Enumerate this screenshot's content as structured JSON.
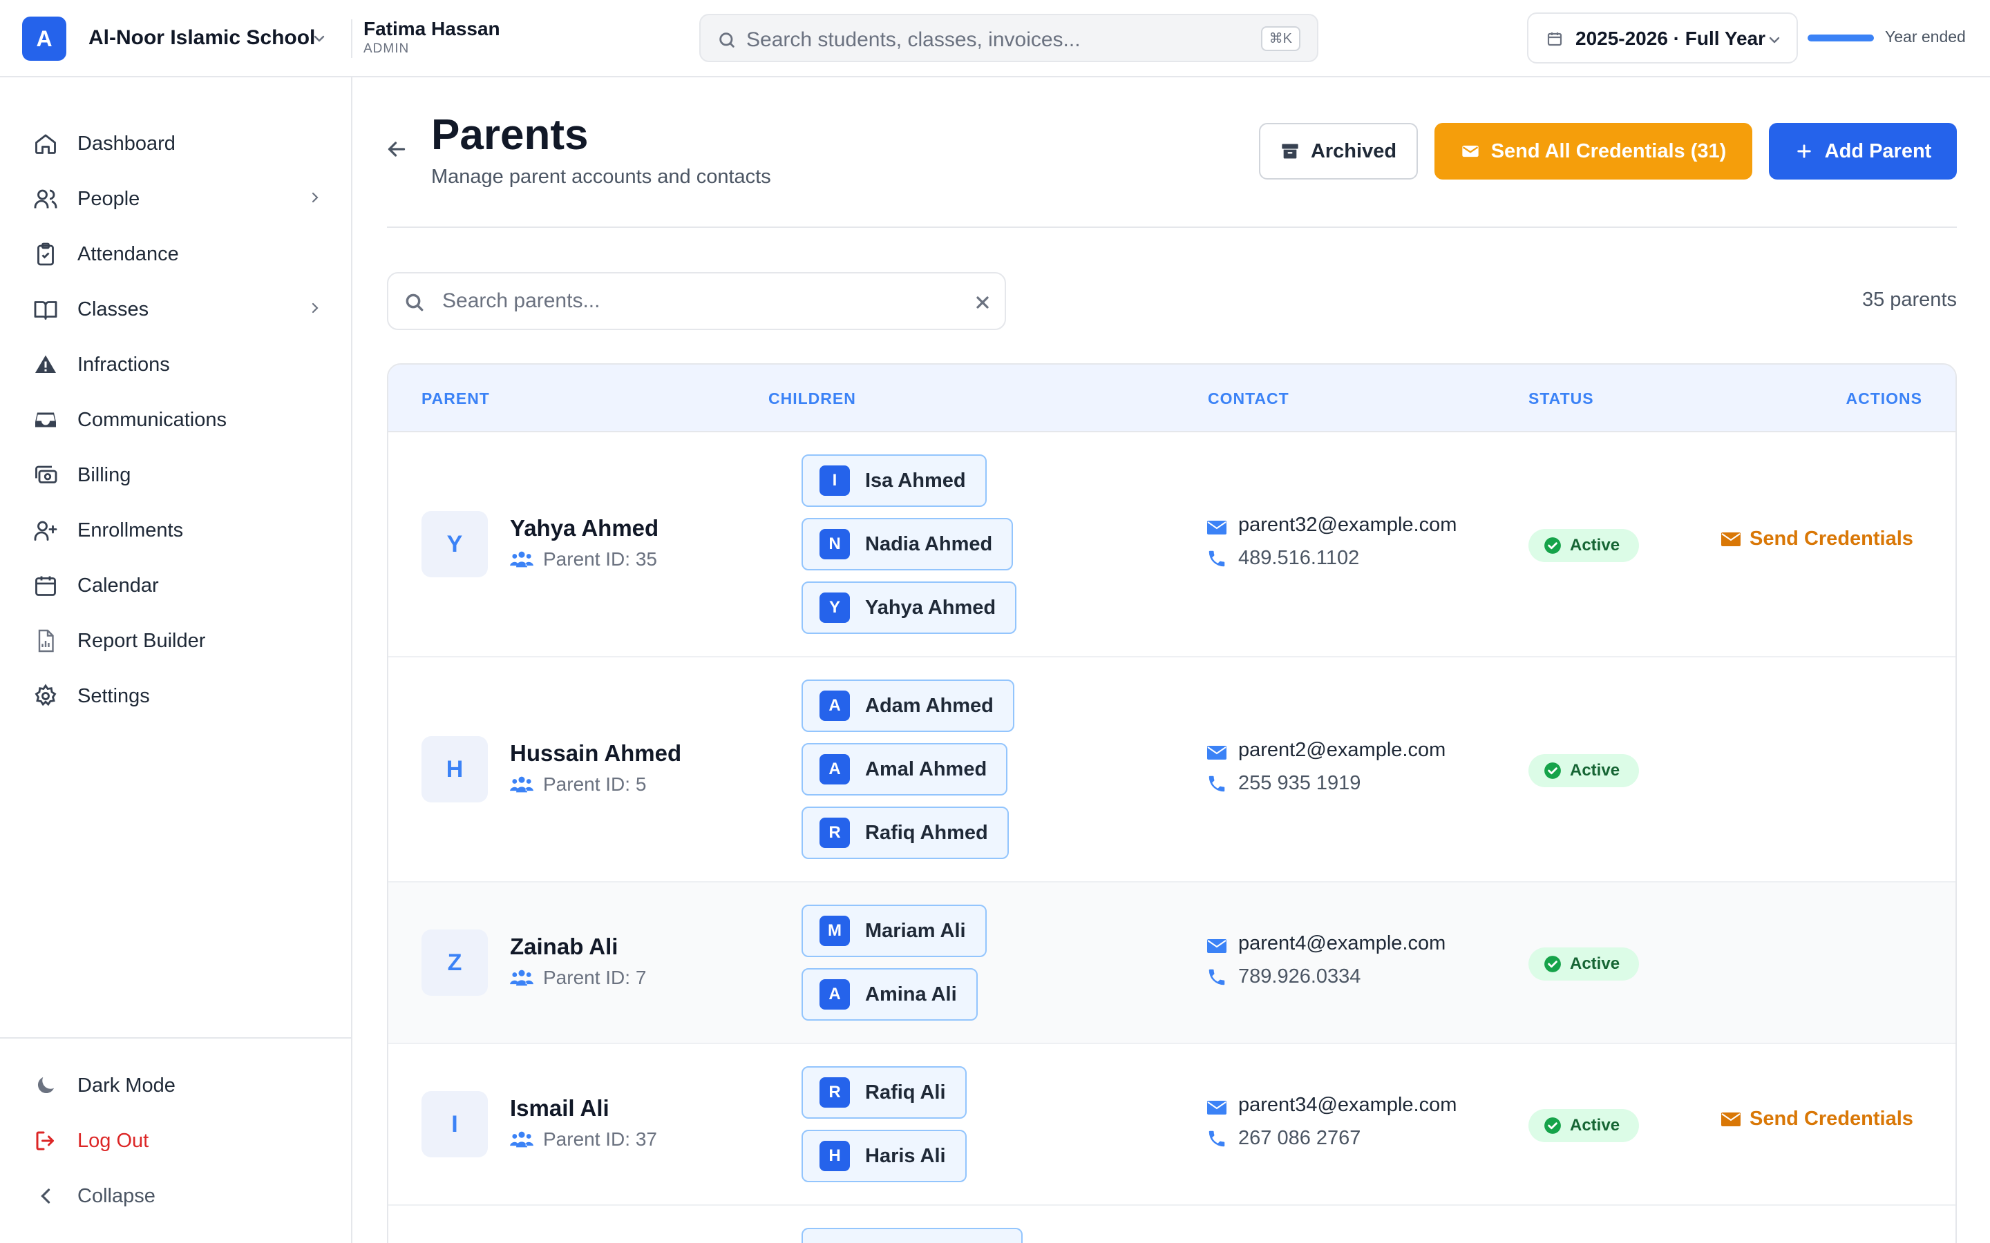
{
  "header": {
    "logo_letter": "A",
    "school_name": "Al-Noor Islamic School",
    "user_name": "Fatima Hassan",
    "user_role": "ADMIN",
    "search_placeholder": "Search students, classes, invoices...",
    "shortcut": "⌘K",
    "year_label": "2025-2026 · Full Year",
    "year_status": "Year ended",
    "year_progress_percent": 100
  },
  "sidebar": {
    "items": [
      {
        "label": "Dashboard",
        "icon": "home-icon"
      },
      {
        "label": "People",
        "icon": "users-icon",
        "has_submenu": true
      },
      {
        "label": "Attendance",
        "icon": "clipboard-check-icon"
      },
      {
        "label": "Classes",
        "icon": "book-open-icon",
        "has_submenu": true
      },
      {
        "label": "Infractions",
        "icon": "warning-triangle-icon"
      },
      {
        "label": "Communications",
        "icon": "inbox-icon"
      },
      {
        "label": "Billing",
        "icon": "billing-icon"
      },
      {
        "label": "Enrollments",
        "icon": "user-plus-icon"
      },
      {
        "label": "Calendar",
        "icon": "calendar-icon"
      },
      {
        "label": "Report Builder",
        "icon": "report-icon"
      },
      {
        "label": "Settings",
        "icon": "gear-icon"
      }
    ],
    "footer": {
      "dark_mode": "Dark Mode",
      "logout": "Log Out",
      "collapse": "Collapse"
    }
  },
  "page": {
    "title": "Parents",
    "subtitle": "Manage parent accounts and contacts",
    "archived_label": "Archived",
    "send_all_label": "Send All Credentials (31)",
    "add_label": "Add Parent",
    "search_placeholder": "Search parents...",
    "count_label": "35 parents"
  },
  "colors": {
    "primary": "#2563eb",
    "accent_orange": "#f59e0b",
    "active_green": "#16a34a",
    "logout_red": "#dc2626"
  },
  "table": {
    "columns": [
      "PARENT",
      "CHILDREN",
      "CONTACT",
      "STATUS",
      "ACTIONS"
    ],
    "rows": [
      {
        "initial": "Y",
        "name": "Yahya Ahmed",
        "parent_id": "Parent ID: 35",
        "children": [
          {
            "initial": "I",
            "name": "Isa Ahmed"
          },
          {
            "initial": "N",
            "name": "Nadia Ahmed"
          },
          {
            "initial": "Y",
            "name": "Yahya Ahmed"
          }
        ],
        "email": "parent32@example.com",
        "phone": "489.516.1102",
        "status": "Active",
        "action": "Send Credentials"
      },
      {
        "initial": "H",
        "name": "Hussain Ahmed",
        "parent_id": "Parent ID: 5",
        "children": [
          {
            "initial": "A",
            "name": "Adam Ahmed"
          },
          {
            "initial": "A",
            "name": "Amal Ahmed"
          },
          {
            "initial": "R",
            "name": "Rafiq Ahmed"
          }
        ],
        "email": "parent2@example.com",
        "phone": "255 935 1919",
        "status": "Active",
        "action": ""
      },
      {
        "initial": "Z",
        "name": "Zainab Ali",
        "parent_id": "Parent ID: 7",
        "children": [
          {
            "initial": "M",
            "name": "Mariam Ali"
          },
          {
            "initial": "A",
            "name": "Amina Ali"
          }
        ],
        "email": "parent4@example.com",
        "phone": "789.926.0334",
        "status": "Active",
        "action": ""
      },
      {
        "initial": "I",
        "name": "Ismail Ali",
        "parent_id": "Parent ID: 37",
        "children": [
          {
            "initial": "R",
            "name": "Rafiq Ali"
          },
          {
            "initial": "H",
            "name": "Haris Ali"
          }
        ],
        "email": "parent34@example.com",
        "phone": "267 086 2767",
        "status": "Active",
        "action": "Send Credentials"
      }
    ]
  }
}
